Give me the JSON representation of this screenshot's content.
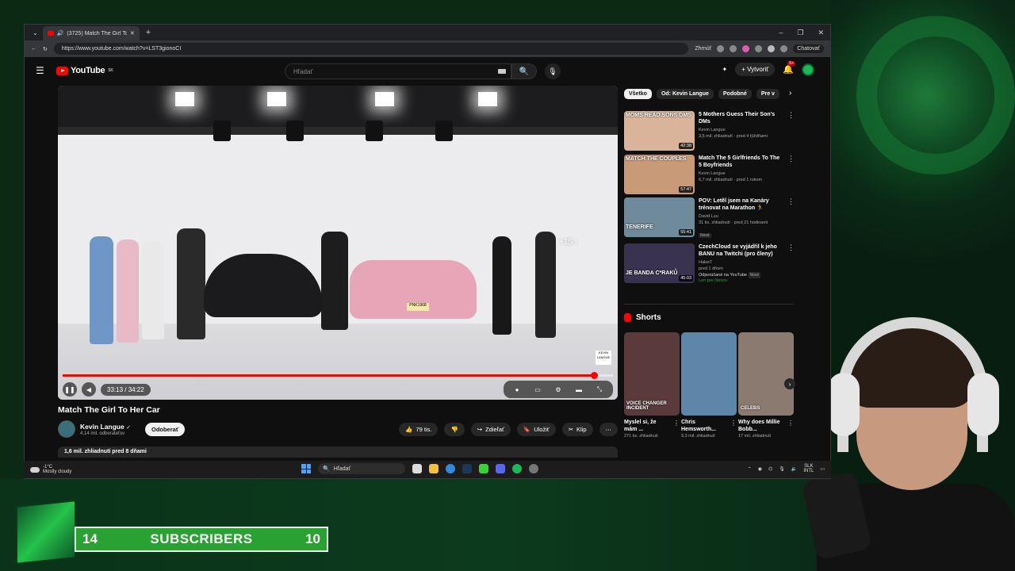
{
  "browser": {
    "tab_title": "(3725) Match The Girl To Her",
    "url": "https://www.youtube.com/watch?v=LST3gionoCI",
    "summarize": "Zhrnúť",
    "chat": "Chatovať"
  },
  "youtube": {
    "logo": "YouTube",
    "region": "SK",
    "search_placeholder": "Hľadať",
    "create": "Vytvoriť",
    "notifications": "9+"
  },
  "player": {
    "time": "33:13 / 34:22",
    "skip_label": "+15",
    "plate": "PNK1968",
    "watermark": "KEVIN LANGUE",
    "progress": 0.966
  },
  "video": {
    "title": "Match The Girl To Her Car",
    "channel": "Kevin Langue",
    "subscribers": "4,14 mil. odberateľov",
    "subscribe": "Odoberať",
    "likes": "79 tis.",
    "share": "Zdieľať",
    "save": "Uložiť",
    "clip": "Klip",
    "stats": "1,6 mil. zhliadnutí  pred 8 dňami"
  },
  "chips": [
    "Všetko",
    "Od: Kevin Langue",
    "Podobné",
    "Pre v"
  ],
  "recommendations": [
    {
      "title": "5 Mothers Guess Their Son's DMs",
      "channel": "Kevin Langue",
      "meta": "3,5 mil. zhliadnutí · pred 4 týždňami",
      "duration": "42:38",
      "thumb_text": "MOMS READ SONS DMS",
      "color": "#d9b49a"
    },
    {
      "title": "Match The 5 Girlfriends To The 5 Boyfriends",
      "channel": "Kevin Langue",
      "meta": "6,7 mil. zhliadnutí · pred 1 rokom",
      "duration": "57:47",
      "thumb_text": "MATCH THE COUPLES",
      "color": "#c99a78"
    },
    {
      "title": "POV: Letěl jsem na Kanáry trénovat na Marathon 🏃",
      "channel": "David Luu",
      "meta": "31 tis. zhliadnutí · pred 21 hodinami",
      "tag": "Nové",
      "duration": "55:41",
      "thumb_text": "TENERIFE",
      "color": "#6f8a9a"
    },
    {
      "title": "CzechCloud se vyjádřil k jeho BANU na Twitchi (pro členy)",
      "channel": "HalseT",
      "meta": "pred 1 dňom",
      "meta2": "Odporúčané na YouTube",
      "tag": "Nové",
      "members": "Len pre členov",
      "duration": "45:03",
      "thumb_text": "JE BANDA C*RAKŮ",
      "color": "#3a3350"
    }
  ],
  "shorts": {
    "header": "Shorts",
    "items": [
      {
        "title": "Myslel si, že mám ...",
        "views": "271 tis. zhliadnutí",
        "caption": "VOICE CHANGER INCIDENT",
        "color": "#5a3a3a"
      },
      {
        "title": "Chris Hemsworth...",
        "views": "9,3 mil. zhliadnutí",
        "caption": "",
        "color": "#5d86a8"
      },
      {
        "title": "Why does Millie Bobb...",
        "views": "17 mil. zhliadnutí",
        "caption": "CELEBS",
        "color": "#8a7a70"
      }
    ]
  },
  "taskbar": {
    "temp": "-1°C",
    "weather": "Mostly cloudy",
    "search": "Hľadať",
    "lang": "SLK",
    "lang2": "INTL"
  },
  "widget": {
    "left_count": "14",
    "label": "SUBSCRIBERS",
    "right_count": "10"
  },
  "colors": {
    "accent": "#ff0000",
    "widget_green": "#29a233"
  }
}
